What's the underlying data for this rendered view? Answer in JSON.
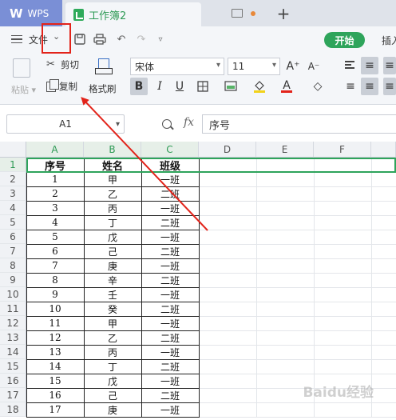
{
  "titlebar": {
    "app_tab": "WPS",
    "doc_tab": "工作簿2",
    "new_tab": "+"
  },
  "menu": {
    "file": "文件",
    "start": "开始",
    "insert": "插入"
  },
  "ribbon": {
    "paste": "粘贴",
    "cut": "剪切",
    "copy": "复制",
    "format_painter": "格式刷",
    "font_name": "宋体",
    "font_size": "11",
    "grow_font": "A⁺",
    "shrink_font": "A⁻",
    "bold": "B",
    "italic": "I",
    "underline": "U",
    "font_color_letter": "A",
    "font_color": "#e2231a",
    "fill_color": "#f2d21b"
  },
  "formula_bar": {
    "cell_ref": "A1",
    "fx": "fx",
    "content": "序号"
  },
  "sheet": {
    "columns": [
      "A",
      "B",
      "C",
      "D",
      "E",
      "F"
    ],
    "selected_row": 1,
    "header_row": [
      "序号",
      "姓名",
      "班级"
    ],
    "rows": [
      [
        "1",
        "甲",
        "一班"
      ],
      [
        "2",
        "乙",
        "二班"
      ],
      [
        "3",
        "丙",
        "一班"
      ],
      [
        "4",
        "丁",
        "二班"
      ],
      [
        "5",
        "戊",
        "一班"
      ],
      [
        "6",
        "己",
        "二班"
      ],
      [
        "7",
        "庚",
        "一班"
      ],
      [
        "8",
        "辛",
        "二班"
      ],
      [
        "9",
        "壬",
        "一班"
      ],
      [
        "10",
        "癸",
        "二班"
      ],
      [
        "11",
        "甲",
        "一班"
      ],
      [
        "12",
        "乙",
        "二班"
      ],
      [
        "13",
        "丙",
        "一班"
      ],
      [
        "14",
        "丁",
        "二班"
      ],
      [
        "15",
        "戊",
        "一班"
      ],
      [
        "16",
        "己",
        "二班"
      ],
      [
        "17",
        "庚",
        "一班"
      ]
    ],
    "row_numbers": [
      "1",
      "2",
      "3",
      "4",
      "5",
      "6",
      "7",
      "8",
      "9",
      "10",
      "11",
      "12",
      "13",
      "14",
      "15",
      "16",
      "17",
      "18"
    ]
  },
  "annotation": {
    "color": "#e2231a"
  },
  "watermark": "Baidu经验"
}
